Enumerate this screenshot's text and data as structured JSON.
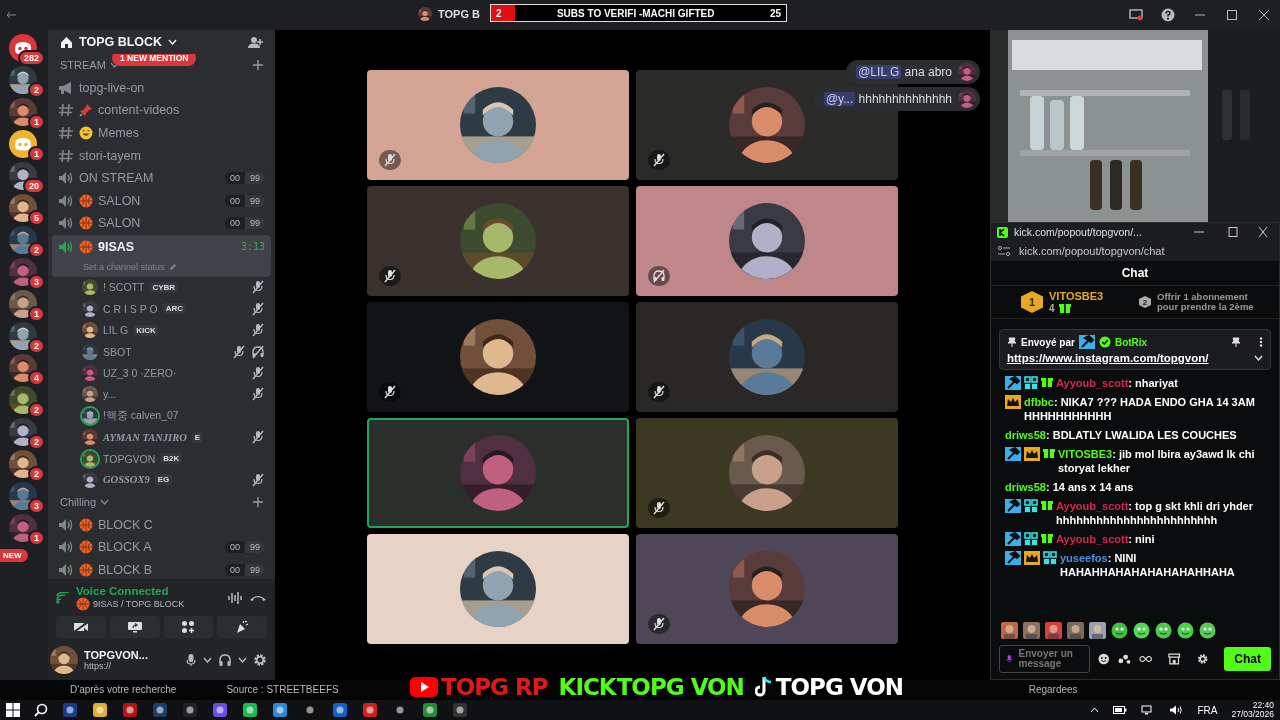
{
  "top_bar": {
    "title": "TOPG B",
    "goal_banner": {
      "current": "2",
      "text": "SUBS TO VERIFI -MACHI GIFTED",
      "target": "25",
      "level": 0.08
    }
  },
  "servers": [
    {
      "badge": "282",
      "kind": "discord"
    },
    {
      "badge": "2",
      "kind": "avatar"
    },
    {
      "badge": "1",
      "kind": "avatar"
    },
    {
      "badge": "1",
      "kind": "discord"
    },
    {
      "badge": "20",
      "kind": "avatar"
    },
    {
      "badge": "5",
      "kind": "avatar"
    },
    {
      "badge": "2",
      "kind": "avatar"
    },
    {
      "badge": "3",
      "kind": "avatar"
    },
    {
      "badge": "1",
      "kind": "avatar"
    },
    {
      "badge": "2",
      "kind": "avatar"
    },
    {
      "badge": "4",
      "kind": "avatar"
    },
    {
      "badge": "2",
      "kind": "avatar"
    },
    {
      "badge": "2",
      "kind": "avatar"
    },
    {
      "badge": "2",
      "kind": "avatar"
    },
    {
      "badge": "3",
      "kind": "avatar"
    },
    {
      "badge": "1",
      "kind": "avatar"
    }
  ],
  "rail_new_pill": "NEW",
  "server_name": "TOPG BLOCK",
  "mention_pill": "1 NEW MENTION",
  "channels": [
    {
      "kind": "category",
      "label": "STREAM"
    },
    {
      "kind": "announcement",
      "label": "topg-live-on",
      "selected": false
    },
    {
      "kind": "text",
      "label": "content-videos",
      "emoji": {
        "kind": "pin"
      },
      "selected": false
    },
    {
      "kind": "text",
      "label": "Memes",
      "emoji": {
        "kind": "laugh"
      },
      "selected": false
    },
    {
      "kind": "text",
      "label": "stori-tayem",
      "selected": false
    },
    {
      "kind": "voice",
      "label": "ON STREAM",
      "count": "00",
      "limit": "99",
      "selected": false
    },
    {
      "kind": "voice",
      "label": "SALON",
      "emoji": {
        "kind": "ball"
      },
      "count": "00",
      "limit": "99",
      "selected": false
    },
    {
      "kind": "voice",
      "label": "SALON",
      "emoji": {
        "kind": "ball"
      },
      "count": "00",
      "limit": "99",
      "selected": false
    },
    {
      "kind": "voice",
      "label": "9ISAS",
      "emoji": {
        "kind": "ball"
      },
      "timer": "3:13",
      "status": "Set a channel status",
      "selected": true,
      "members": [
        {
          "name": "! SCOTT",
          "tag": "CYBR",
          "italic": false,
          "muted": true,
          "deafened": false
        },
        {
          "name": "C R I S P O",
          "tag": "ARC",
          "italic": false,
          "muted": true,
          "deafened": false
        },
        {
          "name": "LIL G",
          "tag": "KICK",
          "italic": false,
          "muted": true,
          "deafened": false
        },
        {
          "name": "SBOT",
          "italic": false,
          "muted": true,
          "deafened": true
        },
        {
          "name": "UZ_3 0 ·ZERO·",
          "italic": false,
          "muted": true,
          "deafened": false
        },
        {
          "name": "y...",
          "italic": false,
          "muted": true,
          "deafened": false
        },
        {
          "name": "!핵중 calven_07",
          "italic": false,
          "muted": false,
          "deafened": false
        },
        {
          "name": "AYMAN TANJIRO",
          "tag": "E",
          "italic": true,
          "muted": true,
          "deafened": false
        },
        {
          "name": "TOPGVON",
          "tag": "B2K",
          "italic": false,
          "muted": false,
          "deafened": false
        },
        {
          "name": "GOSSOX9",
          "tag": "EG",
          "italic": true,
          "muted": true,
          "deafened": false
        }
      ]
    },
    {
      "kind": "category",
      "label": "Chilling"
    },
    {
      "kind": "voice",
      "label": "BLOCK C",
      "emoji": {
        "kind": "ball"
      },
      "selected": false
    },
    {
      "kind": "voice",
      "label": "BLOCK A",
      "emoji": {
        "kind": "ball"
      },
      "count": "00",
      "limit": "99",
      "selected": false
    },
    {
      "kind": "voice",
      "label": "BLOCK B",
      "emoji": {
        "kind": "ball"
      },
      "count": "00",
      "limit": "99",
      "selected": false
    }
  ],
  "voice_panel": {
    "status": "Voice Connected",
    "location": "9ISAS / TOPG BLOCK"
  },
  "user_panel": {
    "name": "TOPGVON...",
    "activity": "https://"
  },
  "notifications": [
    {
      "mention": "@LIL G",
      "text": "ana abro"
    },
    {
      "mention": "@y...",
      "text": "hhhhhhhhhhhhhh"
    }
  ],
  "tiles": [
    {
      "color": "#d4a595",
      "muted": true,
      "deafened": false,
      "speaking": false
    },
    {
      "color": "#2a2b28",
      "muted": true,
      "deafened": false,
      "speaking": false
    },
    {
      "color": "#3a302d",
      "muted": true,
      "deafened": false,
      "speaking": false
    },
    {
      "color": "#c0878a",
      "muted": false,
      "deafened": true,
      "speaking": false
    },
    {
      "color": "#121317",
      "muted": true,
      "deafened": false,
      "speaking": false
    },
    {
      "color": "#2a2826",
      "muted": true,
      "deafened": false,
      "speaking": false
    },
    {
      "color": "#2b2f2c",
      "muted": false,
      "deafened": false,
      "speaking": true
    },
    {
      "color": "#3b3922",
      "muted": true,
      "deafened": false,
      "speaking": false
    },
    {
      "color": "#e6d3c5",
      "muted": false,
      "deafened": false,
      "speaking": false
    },
    {
      "color": "#4f4757",
      "muted": true,
      "deafened": false,
      "speaking": false
    }
  ],
  "kick": {
    "window_title": "kick.com/popout/topgvon/...",
    "url": "kick.com/popout/topgvon/chat",
    "header": "Chat",
    "leader": {
      "rank": "1",
      "name": "VITOSBE3",
      "count": "4"
    },
    "offer": {
      "rank": "2",
      "text": "Offrir 1 abonnement pour prendre la 2ème"
    },
    "pinned": {
      "label": "Envoyé par",
      "user": "BotRix",
      "link": "https://www.instagram.com/topgvon/"
    },
    "messages": [
      {
        "badges": [
          {
            "kind": "mod"
          },
          {
            "kind": "og"
          },
          {
            "kind": "sub"
          }
        ],
        "user": "Ayyoub_scott",
        "color": "#d7264f",
        "text": ": nhariyat"
      },
      {
        "badges": [
          {
            "kind": "vip"
          }
        ],
        "user": "dfbbc",
        "color": "#53fc18",
        "text": ": NIKA7 ??? HADA ENDO GHA 14 3AM HHHHHHHHHHH"
      },
      {
        "user": "driws58",
        "color": "#53fc18",
        "text": ": BDLATLY LWALIDA LES COUCHES"
      },
      {
        "badges": [
          {
            "kind": "mod"
          },
          {
            "kind": "vip"
          },
          {
            "kind": "sub"
          }
        ],
        "user": "VITOSBE3",
        "color": "#53fc18",
        "text": ": jib mol lbira ay3awd lk chi storyat lekher"
      },
      {
        "user": "driws58",
        "color": "#53fc18",
        "text": ": 14 ans x 14 ans"
      },
      {
        "badges": [
          {
            "kind": "mod"
          },
          {
            "kind": "og"
          },
          {
            "kind": "sub"
          }
        ],
        "user": "Ayyoub_scott",
        "color": "#d7264f",
        "text": ": top g skt khli dri yhder hhhhhhhhhhhhhhhhhhhhhhhh"
      },
      {
        "badges": [
          {
            "kind": "mod"
          },
          {
            "kind": "og"
          },
          {
            "kind": "sub"
          }
        ],
        "user": "Ayyoub_scott",
        "color": "#d7264f",
        "text": ": nini"
      },
      {
        "badges": [
          {
            "kind": "mod"
          },
          {
            "kind": "vip"
          },
          {
            "kind": "og"
          }
        ],
        "user": "yuseefos",
        "color": "#4f8fe0",
        "text": ": NINI HAHAHHAHAHAHAHAHAHHAHA"
      }
    ],
    "input_placeholder": "Envoyer un message",
    "send_button": "Chat"
  },
  "background_texts": [
    "D'après votre recherche",
    "Source : STREETBEEFS",
    "Regardees"
  ],
  "stream_overlay": [
    "TOPG RP",
    "KICK",
    "TOPG VON",
    "TOPG VON"
  ],
  "taskbar": {
    "language": "FRA",
    "time": "22:40",
    "date": "27/03/2026"
  }
}
